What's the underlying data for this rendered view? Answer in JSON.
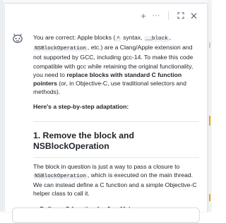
{
  "toolbar": {
    "icons": [
      "plus-icon",
      "more-icon",
      "expand-icon",
      "close-icon"
    ],
    "plus": "+",
    "more": "···",
    "expand": "⛶",
    "close": "✕"
  },
  "message": {
    "p1_a": "You are correct: Apple blocks (",
    "code_caret": "^",
    "p1_b": " syntax, ",
    "code_block": "__block",
    "p1_c": ",",
    "code_nsblock": "NSBlockOperation",
    "p1_d": ", etc.) are a Clang/Apple extension and not supported by GCC, including gcc-14. To make this code compatible with gcc while retaining the original functionality, you need to ",
    "p1_bold": "replace blocks with standard C function pointers",
    "p1_e": " (or, in Objective-C, use traditional selectors and methods).",
    "p2": "Here's a step-by-step adaptation:",
    "h2": "1. Remove the block and NSBlockOperation",
    "p3_a": "The block in question is just a way to pass a closure to ",
    "code_nsblock2": "NSBlockOperation",
    "p3_b": ", which is executed on the main thread. We can instead define a C function and a simple Objective-C helper class to call it.",
    "h4": "a. Define a C function for JavaMain"
  },
  "colors": {
    "accent_orange": "#f0a500",
    "text": "#1f2328",
    "icon_gray": "#6b7280"
  }
}
